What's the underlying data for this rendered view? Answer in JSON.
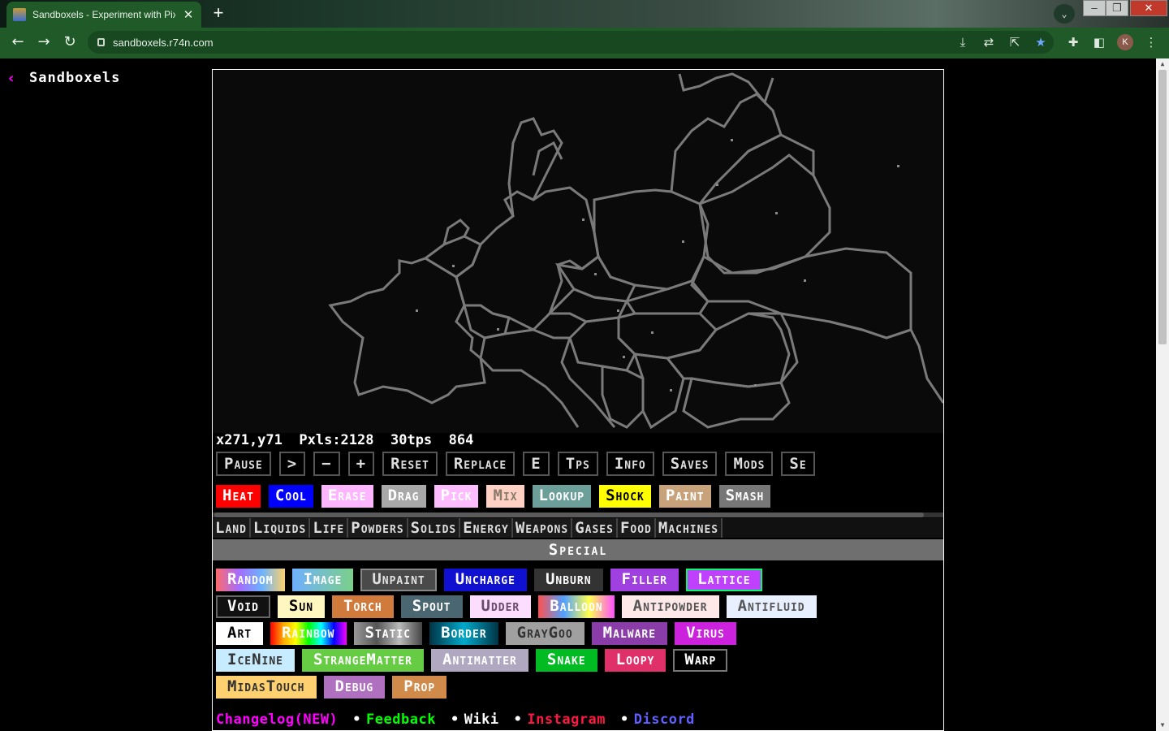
{
  "browser": {
    "tab_title": "Sandboxels - Experiment with Pix",
    "url": "sandboxels.r74n.com",
    "profile_initial": "K"
  },
  "page": {
    "back_glyph": "‹",
    "brand": "Sandboxels"
  },
  "stats": {
    "coords": "x271,y71",
    "pixels": "Pxls:2128",
    "tps": "30tps",
    "tick": "864"
  },
  "controls": [
    "Pause",
    ">",
    "−",
    "+",
    "Reset",
    "Replace",
    "E",
    "Tps",
    "Info",
    "Saves",
    "Mods",
    "Se"
  ],
  "tools": [
    {
      "label": "Heat",
      "bg": "#ff0000",
      "fg": "#ffffff"
    },
    {
      "label": "Cool",
      "bg": "#0000ff",
      "fg": "#ffffff"
    },
    {
      "label": "Erase",
      "bg": "#fdb5ff",
      "fg": "#ffffff"
    },
    {
      "label": "Drag",
      "bg": "#a8a8a8",
      "fg": "#ffffff"
    },
    {
      "label": "Pick",
      "bg": "#fcbcff",
      "fg": "#ffffff"
    },
    {
      "label": "Mix",
      "bg": "#ffd0c4",
      "fg": "#8a7a6a"
    },
    {
      "label": "Lookup",
      "bg": "#6d9f9a",
      "fg": "#ffffff"
    },
    {
      "label": "Shock",
      "bg": "#ffff00",
      "fg": "#000000"
    },
    {
      "label": "Paint",
      "bg": "#c8a27a",
      "fg": "#ffffff"
    },
    {
      "label": "Smash",
      "bg": "#777777",
      "fg": "#ffffff"
    }
  ],
  "categories": [
    "Land",
    "Liquids",
    "Life",
    "Powders",
    "Solids",
    "Energy",
    "Weapons",
    "Gases",
    "Food",
    "Machines"
  ],
  "active_category": "Special",
  "elements": [
    [
      {
        "label": "Random",
        "bg": "linear-gradient(90deg,#ff6b6b,#a66bff,#6bb3ff,#ffd26b)",
        "fg": "#ffffff"
      },
      {
        "label": "Image",
        "bg": "linear-gradient(90deg,#6fb0ff,#7bd08a)",
        "fg": "#ffffff"
      },
      {
        "label": "Unpaint",
        "bg": "#4a4a4a",
        "fg": "#e0e0e0",
        "border": "#888"
      },
      {
        "label": "Uncharge",
        "bg": "#1010d0",
        "fg": "#ffffff"
      },
      {
        "label": "Unburn",
        "bg": "#333333",
        "fg": "#ffffff"
      },
      {
        "label": "Filler",
        "bg": "#a040e0",
        "fg": "#ffffff"
      },
      {
        "label": "Lattice",
        "bg": "#c040ff",
        "fg": "#ffffff",
        "border": "#00ff66"
      }
    ],
    [
      {
        "label": "Void",
        "bg": "#111111",
        "fg": "#ffffff",
        "border": "#666"
      },
      {
        "label": "Sun",
        "bg": "#fff6c0",
        "fg": "#000000"
      },
      {
        "label": "Torch",
        "bg": "#d07a3c",
        "fg": "#ffffff"
      },
      {
        "label": "Spout",
        "bg": "#4a6670",
        "fg": "#ffffff"
      },
      {
        "label": "Udder",
        "bg": "#fcdcff",
        "fg": "#6a4a6a"
      },
      {
        "label": "Balloon",
        "bg": "linear-gradient(90deg,#ff5050,#50a0ff,#ffff50,#ff50ff)",
        "fg": "#ffffff"
      },
      {
        "label": "Antipowder",
        "bg": "#ffe8e8",
        "fg": "#555555"
      },
      {
        "label": "Antifluid",
        "bg": "#e8f0ff",
        "fg": "#555555"
      }
    ],
    [
      {
        "label": "Art",
        "bg": "#ffffff",
        "fg": "#000000"
      },
      {
        "label": "Rainbow",
        "bg": "linear-gradient(90deg,#ff0000,#ffa500,#ffff00,#00ff00,#00ffff,#0000ff,#ff00ff)",
        "fg": "#ffffff"
      },
      {
        "label": "Static",
        "bg": "linear-gradient(90deg,#999,#555,#bbb,#444)",
        "fg": "#ffffff"
      },
      {
        "label": "Border",
        "bg": "linear-gradient(90deg,#003344,#00aacc,#003344)",
        "fg": "#ffffff"
      },
      {
        "label": "GrayGoo",
        "bg": "#a0a0a0",
        "fg": "#333333"
      },
      {
        "label": "Malware",
        "bg": "#8a3ca8",
        "fg": "#ffffff"
      },
      {
        "label": "Virus",
        "bg": "#cc22dd",
        "fg": "#ffffff"
      }
    ],
    [
      {
        "label": "IceNine",
        "bg": "#c8ecff",
        "fg": "#333333"
      },
      {
        "label": "StrangeMatter",
        "bg": "#66cc44",
        "fg": "#ffffff"
      },
      {
        "label": "Antimatter",
        "bg": "#b0a8c0",
        "fg": "#ffffff"
      },
      {
        "label": "Snake",
        "bg": "#00bb22",
        "fg": "#ffffff"
      },
      {
        "label": "Loopy",
        "bg": "#e0306a",
        "fg": "#ffffff"
      },
      {
        "label": "Warp",
        "bg": "#000000",
        "fg": "#ffffff",
        "border": "#777"
      }
    ],
    [
      {
        "label": "MidasTouch",
        "bg": "#ffd070",
        "fg": "#333333"
      },
      {
        "label": "Debug",
        "bg": "#b070c0",
        "fg": "#ffffff"
      },
      {
        "label": "Prop",
        "bg": "#d08a4a",
        "fg": "#ffffff"
      }
    ]
  ],
  "links": [
    {
      "label": "Changelog(NEW)",
      "color": "#ff00ff"
    },
    {
      "label": "Feedback",
      "color": "#00ff00"
    },
    {
      "label": "Wiki",
      "color": "#ffffff"
    },
    {
      "label": "Instagram",
      "color": "#ff1744"
    },
    {
      "label": "Discord",
      "color": "#6060ff"
    }
  ],
  "link_separator": "•"
}
